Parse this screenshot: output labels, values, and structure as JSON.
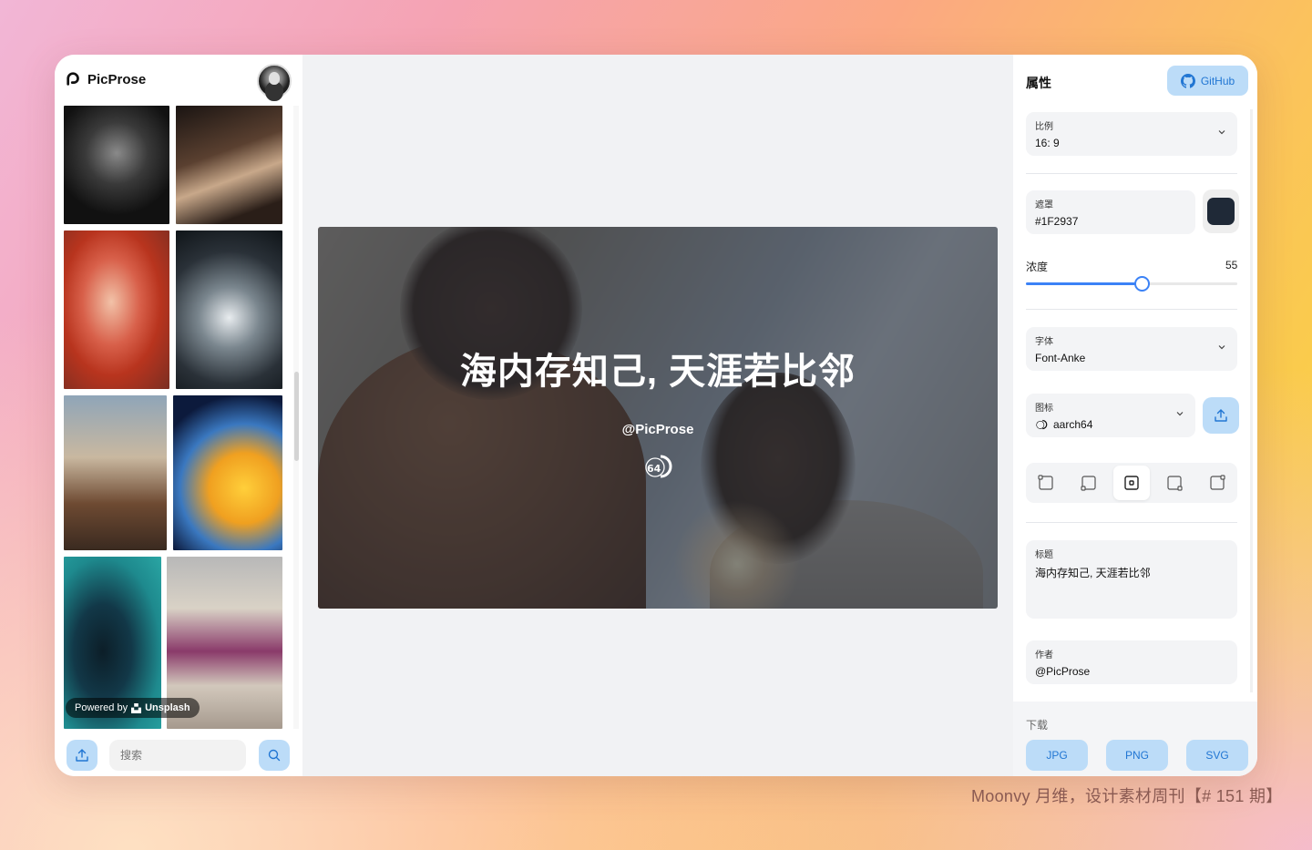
{
  "app": {
    "brand_name": "PicProse"
  },
  "sidebar": {
    "powered_by": "Powered by",
    "powered_brand": "Unsplash",
    "search_placeholder": "搜索"
  },
  "canvas": {
    "title": "海内存知己, 天涯若比邻",
    "author": "@PicProse",
    "mask_color": "#1F2937"
  },
  "panel": {
    "title": "属性",
    "github_label": "GitHub",
    "ratio": {
      "label": "比例",
      "value": "16: 9"
    },
    "mask": {
      "label": "遮罩",
      "value": "#1F2937",
      "swatch": "#1F2937"
    },
    "opacity": {
      "label": "浓度",
      "value": "55",
      "level": 55
    },
    "font": {
      "label": "字体",
      "value": "Font-Anke"
    },
    "icon": {
      "label": "图标",
      "value": "aarch64"
    },
    "position_active": 3,
    "title_field": {
      "label": "标题",
      "value": "海内存知己, 天涯若比邻"
    },
    "author_field": {
      "label": "作者",
      "value": "@PicProse"
    },
    "download": {
      "label": "下载",
      "jpg": "JPG",
      "png": "PNG",
      "svg": "SVG"
    }
  },
  "footer": {
    "credit": "Moonvy 月维，设计素材周刊【# 151 期】"
  },
  "colors": {
    "accent": "#3b82f6",
    "accent_light": "#bcdcf8",
    "accent_text": "#2176d3"
  }
}
